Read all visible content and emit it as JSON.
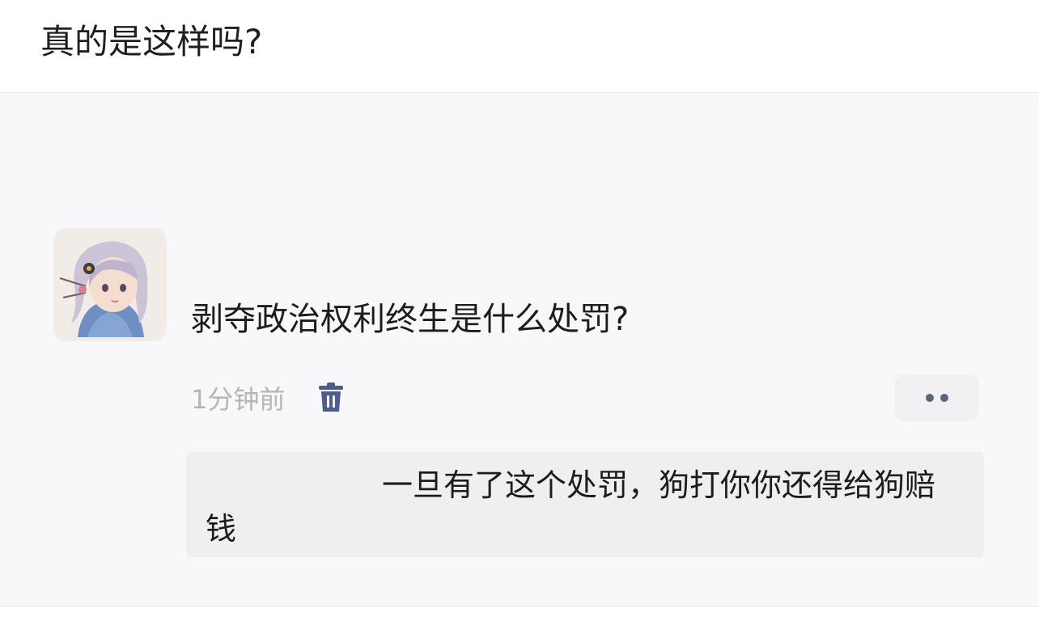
{
  "post": {
    "title": "真的是这样吗?"
  },
  "comment": {
    "username": "",
    "text": "剥夺政治权利终生是什么处罚?",
    "timestamp": "1分钟前",
    "delete_icon": "trash-icon",
    "more_icon": "more-dots-icon"
  },
  "reply": {
    "author": "",
    "text": "一旦有了这个处罚，狗打你你还得给狗赔钱"
  },
  "colors": {
    "page_background": "#ffffff",
    "card_background": "#f8f8fa",
    "reply_background": "#efeff3",
    "timestamp": "#b4b4ba",
    "icon_accent": "#4d5d8c"
  }
}
